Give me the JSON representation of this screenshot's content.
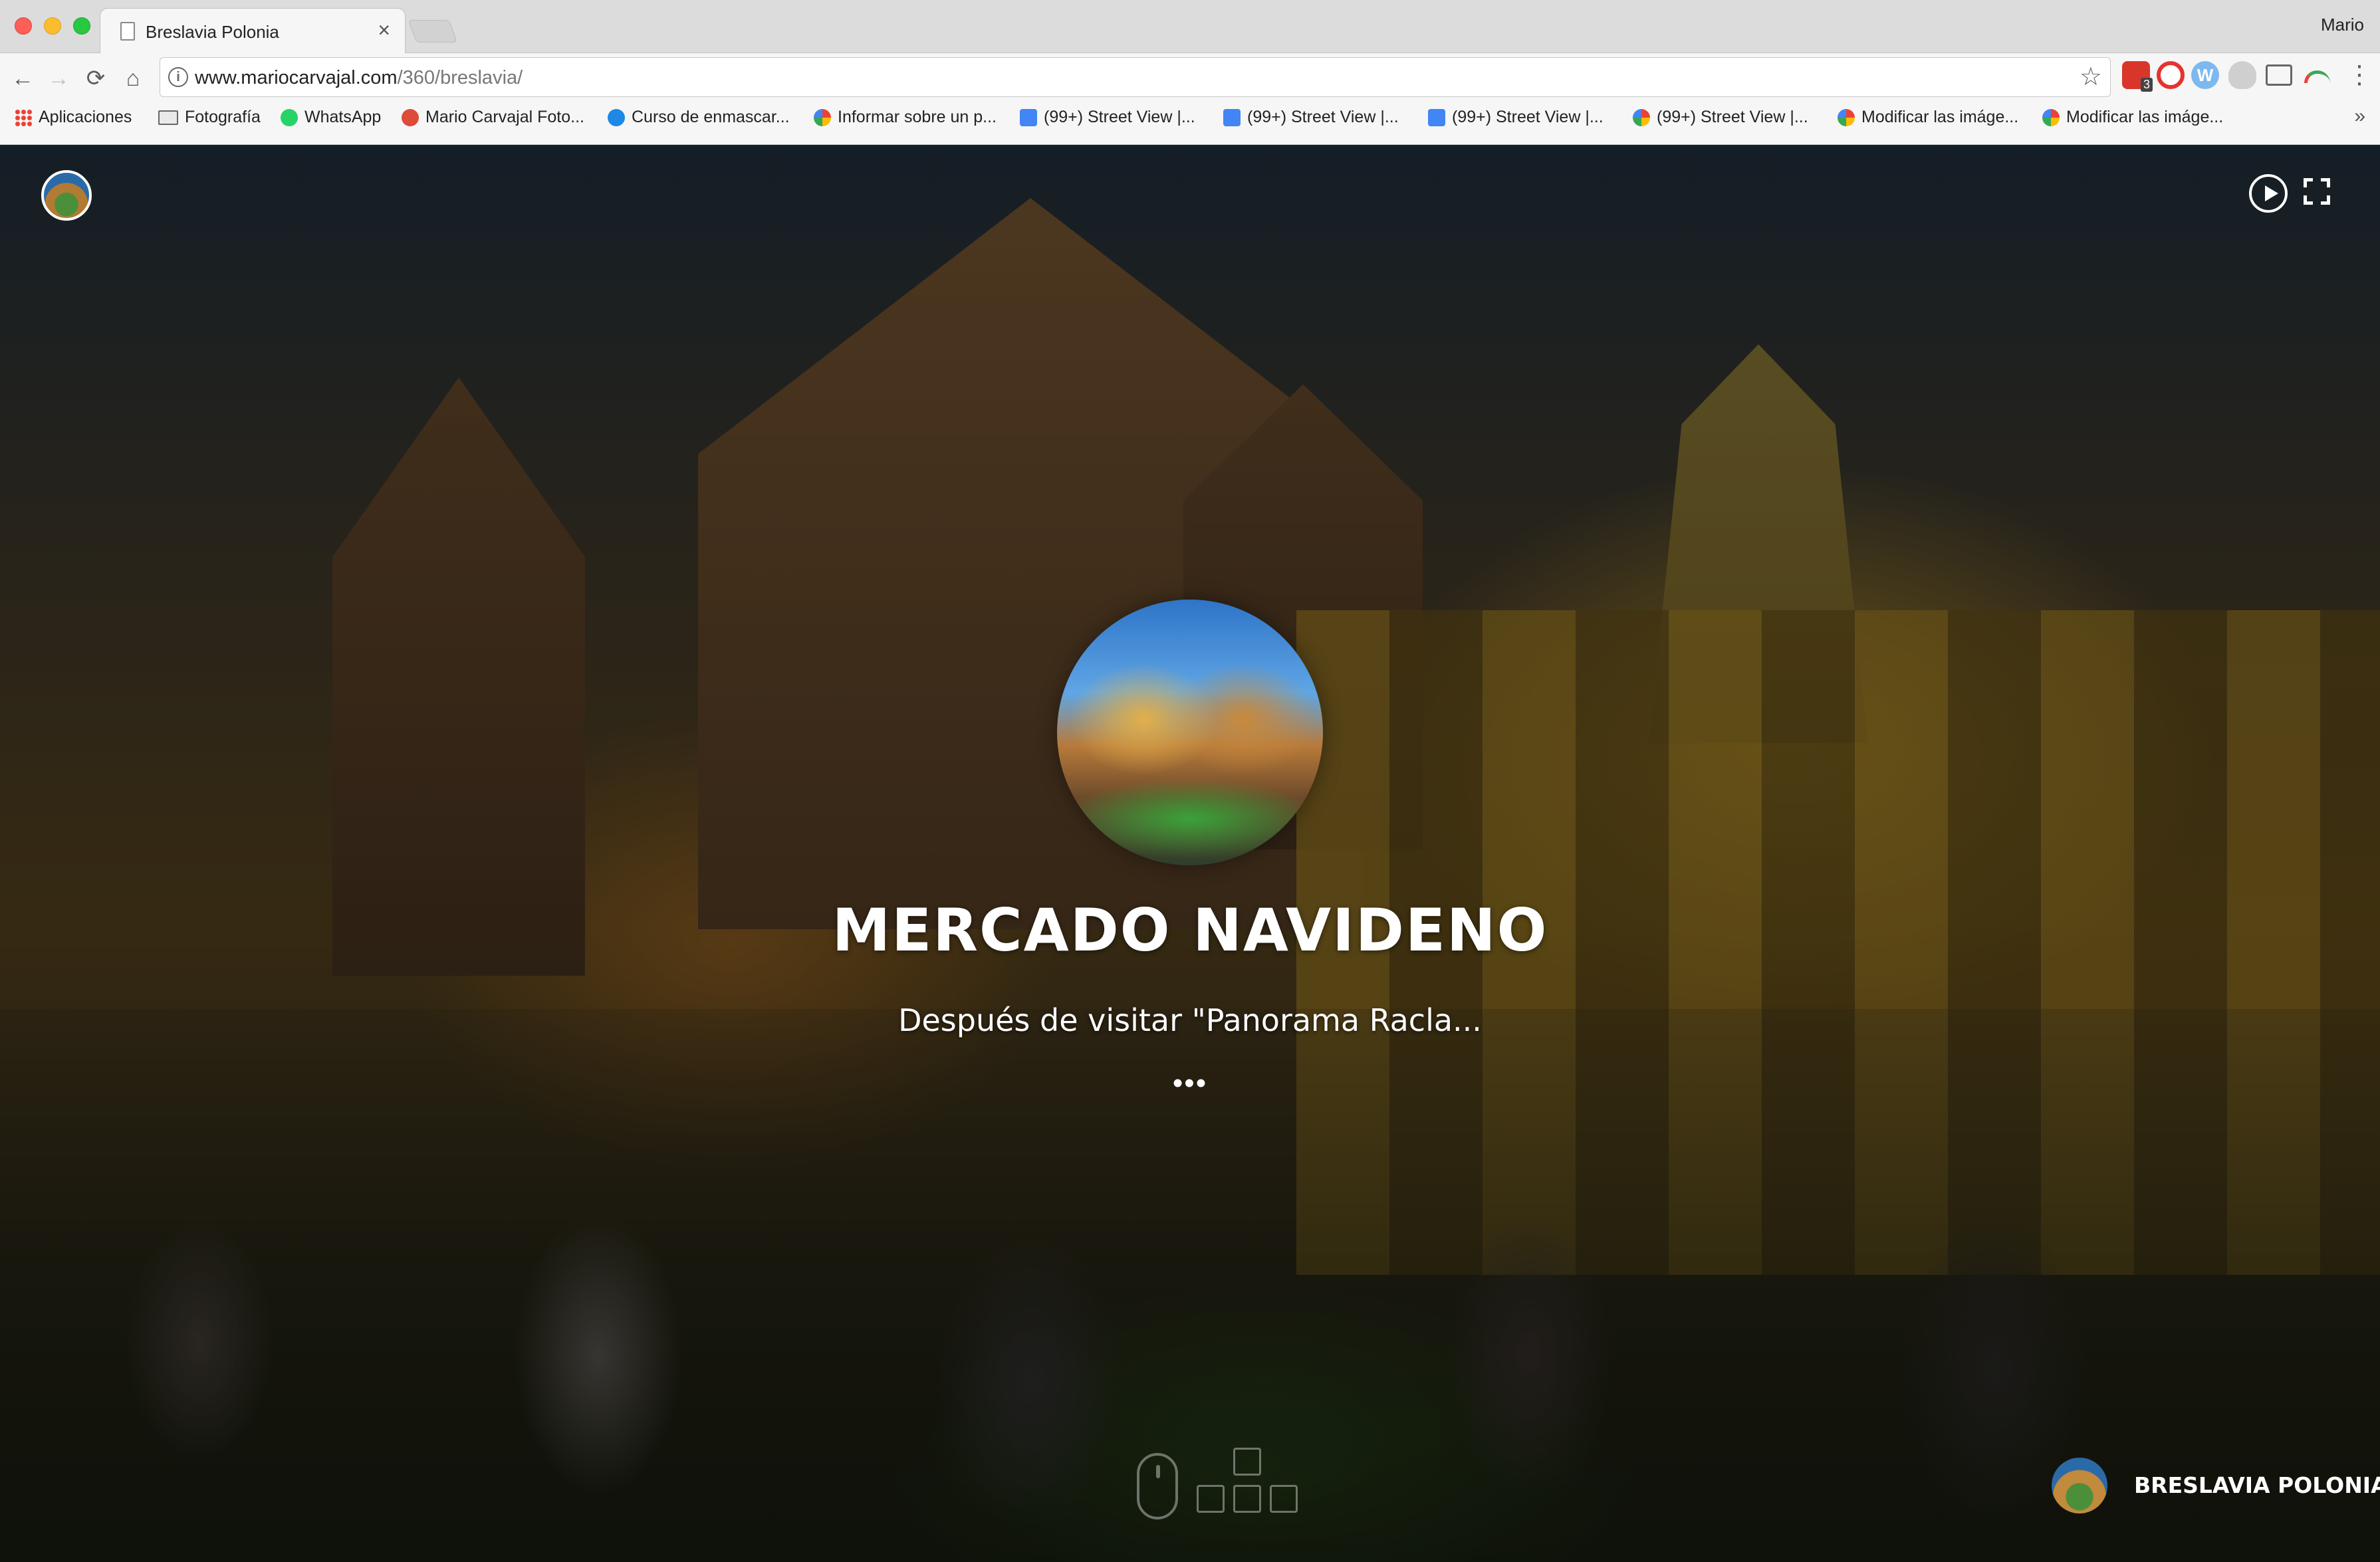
{
  "browser": {
    "tab_title": "Breslavia Polonia",
    "tab_close": "×",
    "user_name": "Mario",
    "url_host": "www.mariocarvajal.com",
    "url_path": "/360/breslavia/",
    "nav": {
      "back": "←",
      "forward": "→",
      "reload": "⟳",
      "home": "⌂"
    },
    "star": "☆",
    "menu": "⋮",
    "bookmarks": [
      {
        "label": "Aplicaciones",
        "icon": "apps-icon"
      },
      {
        "label": "Fotografía",
        "icon": "folder-icon"
      },
      {
        "label": "WhatsApp",
        "icon": "whatsapp-icon"
      },
      {
        "label": "Mario Carvajal Foto...",
        "icon": "google-plus-icon"
      },
      {
        "label": "Curso de enmascar...",
        "icon": "course-icon"
      },
      {
        "label": "Informar sobre un p...",
        "icon": "google-icon"
      },
      {
        "label": "(99+) Street View |...",
        "icon": "street-view-icon"
      },
      {
        "label": "(99+) Street View |...",
        "icon": "street-view-icon"
      },
      {
        "label": "(99+) Street View |...",
        "icon": "street-view-icon"
      },
      {
        "label": "(99+) Street View |...",
        "icon": "google-icon"
      },
      {
        "label": "Modificar las imáge...",
        "icon": "google-icon"
      },
      {
        "label": "Modificar las imáge...",
        "icon": "google-icon"
      }
    ],
    "bookmarks_more": "»"
  },
  "tour": {
    "scene_title": "MERCADO NAVIDENO",
    "scene_description": "Después de visitar \"Panorama Racla...",
    "more": "•••",
    "tour_name": "BRESLAVIA POLONIA"
  }
}
